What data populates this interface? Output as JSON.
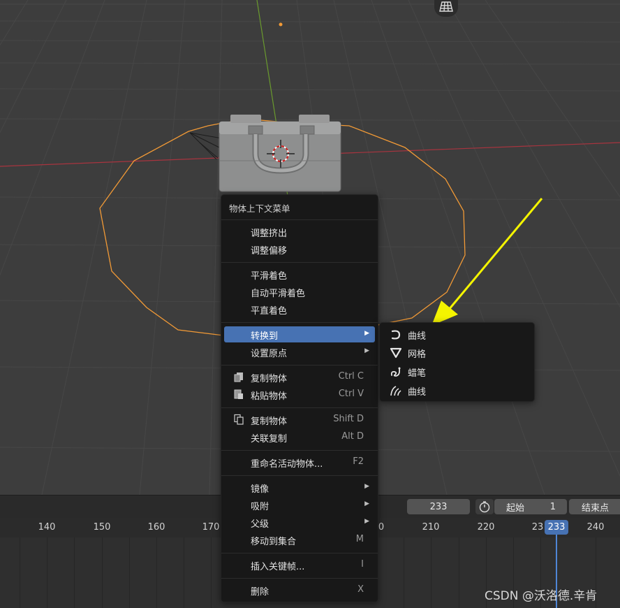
{
  "context_menu": {
    "title": "物体上下文菜单",
    "items": [
      {
        "label": "调整挤出"
      },
      {
        "label": "调整偏移"
      },
      {
        "label": "平滑着色"
      },
      {
        "label": "自动平滑着色"
      },
      {
        "label": "平直着色"
      },
      {
        "label": "转换到",
        "submenu": true,
        "active": true
      },
      {
        "label": "设置原点",
        "submenu": true
      },
      {
        "label": "复制物体",
        "shortcut": "Ctrl C",
        "icon": "copy-icon"
      },
      {
        "label": "粘贴物体",
        "shortcut": "Ctrl V",
        "icon": "paste-icon"
      },
      {
        "label": "复制物体",
        "shortcut": "Shift D",
        "icon": "duplicate-icon"
      },
      {
        "label": "关联复制",
        "shortcut": "Alt D"
      },
      {
        "label": "重命名活动物体...",
        "shortcut": "F2"
      },
      {
        "label": "镜像",
        "submenu": true
      },
      {
        "label": "吸附",
        "submenu": true
      },
      {
        "label": "父级",
        "submenu": true
      },
      {
        "label": "移动到集合",
        "shortcut": "M"
      },
      {
        "label": "插入关键帧...",
        "shortcut": "I"
      },
      {
        "label": "删除",
        "shortcut": "X"
      }
    ]
  },
  "submenu": {
    "items": [
      {
        "label": "曲线",
        "icon": "curve-icon"
      },
      {
        "label": "网格",
        "icon": "mesh-icon"
      },
      {
        "label": "蜡笔",
        "icon": "grease-pencil-icon"
      },
      {
        "label": "曲线",
        "icon": "curves-hair-icon"
      }
    ]
  },
  "timeline": {
    "current_frame": "233",
    "start_label": "起始",
    "start_value": "1",
    "end_label": "结束点",
    "ruler_ticks": [
      "140",
      "150",
      "160",
      "170",
      "0",
      "210",
      "220",
      "23",
      "240"
    ],
    "playhead": "233"
  },
  "watermark": "CSDN @沃洛德.辛肯",
  "colors": {
    "accent": "#4772b3",
    "selection_outline": "#f29a36",
    "annotation_arrow": "#f4f400"
  }
}
